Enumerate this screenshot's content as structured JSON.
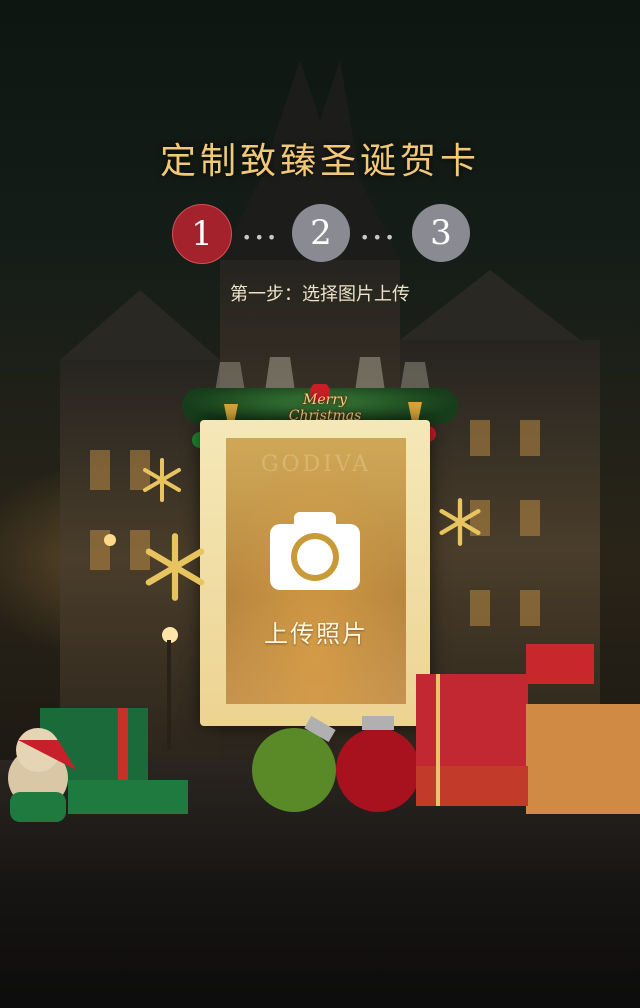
{
  "header": {
    "title": "定制致臻圣诞贺卡"
  },
  "steps": [
    {
      "number": "1",
      "state": "active"
    },
    {
      "number": "2",
      "state": "inactive"
    },
    {
      "number": "3",
      "state": "inactive"
    }
  ],
  "step_description": "第一步：选择图片上传",
  "card": {
    "banner_text": "Merry Christmas",
    "upload_label": "上传照片"
  },
  "branding": {
    "brand": "GODIVA"
  },
  "colors": {
    "title_gold": "#f0c878",
    "step_active": "#a3222b",
    "step_inactive": "#8a8a92",
    "frame": "#f5e8b8"
  }
}
